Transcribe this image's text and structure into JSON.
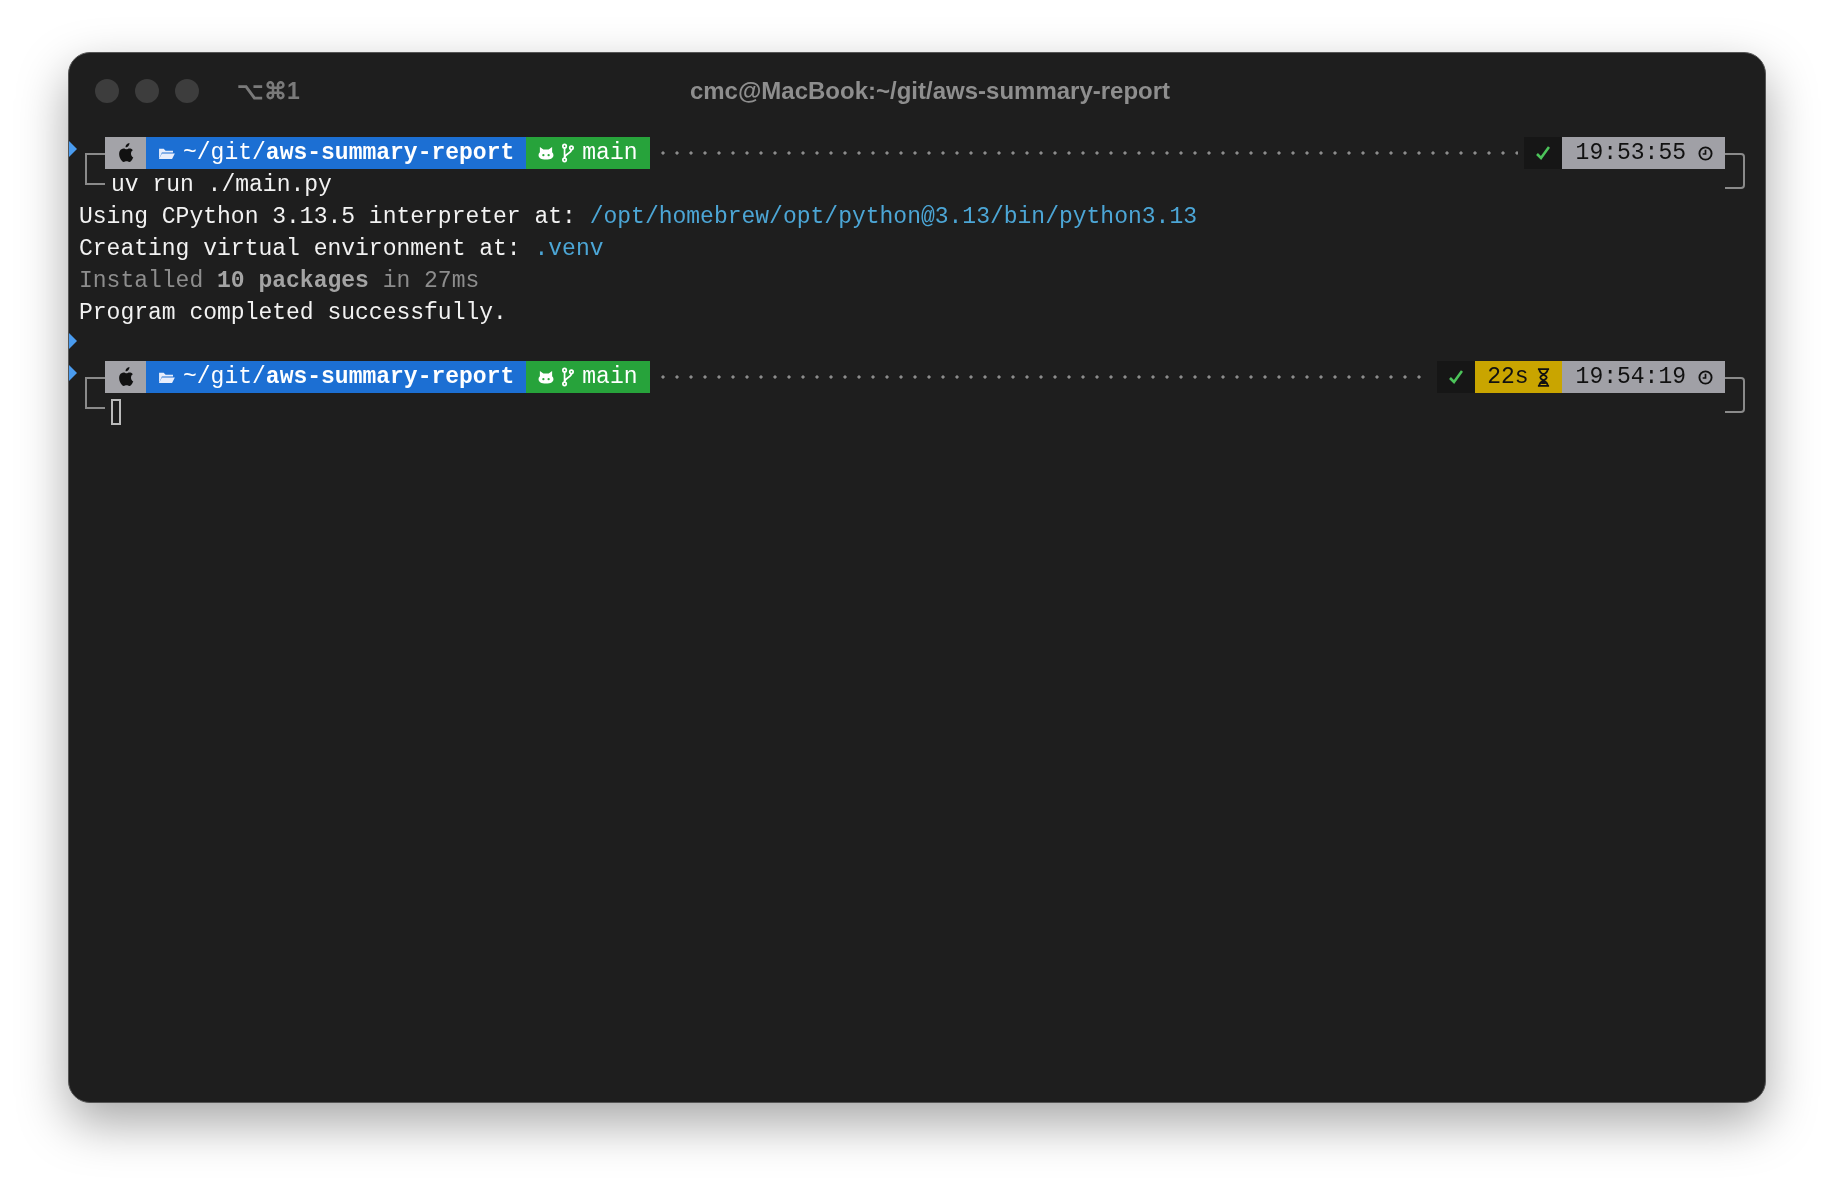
{
  "window": {
    "title": "cmc@MacBook:~/git/aws-summary-report",
    "shortcut": "⌥⌘1"
  },
  "blocks": [
    {
      "prompt": {
        "path": "~/git/**aws-summary-report**",
        "branch": "main",
        "exit_ok": true,
        "time": "19:53:55"
      },
      "command": "uv run ./main.py",
      "output": [
        {
          "kind": "plain",
          "parts": [
            {
              "kind": "text",
              "text": "Using CPython 3.13.5 interpreter at: "
            },
            {
              "kind": "path",
              "text": "/opt/homebrew/opt/python@3.13/bin/python3.13"
            }
          ]
        },
        {
          "kind": "plain",
          "parts": [
            {
              "kind": "text",
              "text": "Creating virtual environment at: "
            },
            {
              "kind": "path",
              "text": ".venv"
            }
          ]
        },
        {
          "kind": "dim",
          "parts": [
            {
              "kind": "text",
              "text": "Installed **10 packages** in 27ms"
            }
          ]
        },
        {
          "kind": "plain",
          "parts": [
            {
              "kind": "text",
              "text": "Program completed successfully."
            }
          ]
        }
      ]
    },
    {
      "prompt": {
        "path": "~/git/**aws-summary-report**",
        "branch": "main",
        "exit_ok": true,
        "duration": "22s",
        "time": "19:54:19"
      },
      "cursor": true
    }
  ]
}
